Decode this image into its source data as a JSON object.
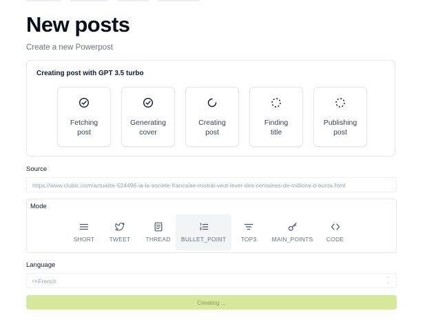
{
  "header": {
    "title": "New posts",
    "subtitle": "Create a new Powerpost"
  },
  "progress": {
    "title": "Creating post with GPT 3.5 turbo",
    "steps": [
      {
        "label": "Fetching\npost",
        "status": "done",
        "icon": "check-circle-icon"
      },
      {
        "label": "Generating\ncover",
        "status": "done",
        "icon": "check-circle-icon"
      },
      {
        "label": "Creating\npost",
        "status": "in-progress",
        "icon": "spinner-icon"
      },
      {
        "label": "Finding\ntitle",
        "status": "pending",
        "icon": "dashed-circle-icon"
      },
      {
        "label": "Publishing\npost",
        "status": "pending",
        "icon": "dashed-circle-icon"
      }
    ]
  },
  "source": {
    "label": "Source",
    "value": "https://www.clubic.com/actualite-524496-ia-la-societe-francaise-mistral-veut-lever-des-centaines-de-millions-d-euros.html"
  },
  "mode": {
    "label": "Mode",
    "selected": "BULLET_POINT",
    "options": [
      {
        "label": "SHORT",
        "icon": "menu-lines-icon"
      },
      {
        "label": "TWEET",
        "icon": "twitter-bird-icon"
      },
      {
        "label": "THREAD",
        "icon": "document-icon"
      },
      {
        "label": "BULLET_POINT",
        "icon": "list-ordered-icon"
      },
      {
        "label": "TOP3",
        "icon": "filter-icon"
      },
      {
        "label": "MAIN_POINTS",
        "icon": "key-icon"
      },
      {
        "label": "CODE",
        "icon": "code-brackets-icon"
      }
    ]
  },
  "language": {
    "label": "Language",
    "flag": "FR",
    "value": "French"
  },
  "submit": {
    "label": "Creating ..."
  },
  "colors": {
    "accent": "#d5e89b",
    "accent_text": "#8a9a5b"
  }
}
